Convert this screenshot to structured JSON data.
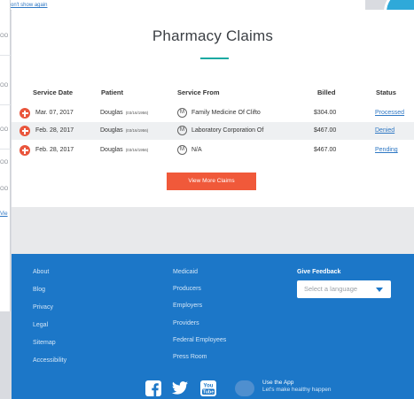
{
  "background": {
    "top_link_fragment": "on't show again",
    "side_fragments": [
      "OO",
      "OO",
      "OO",
      "OO",
      "OO"
    ],
    "side_link_fragment": "Vie"
  },
  "modal": {
    "title": "Pharmacy Claims",
    "columns": {
      "service_date": "Service Date",
      "patient": "Patient",
      "service_from": "Service From",
      "billed": "Billed",
      "status": "Status"
    },
    "rows": [
      {
        "service_date": "Mar. 07, 2017",
        "patient": "Douglas",
        "dob": "(03/16/1956)",
        "badge": "M",
        "service_from": "Family Medicine Of Clifto",
        "billed": "$304.00",
        "status": "Processed"
      },
      {
        "service_date": "Feb. 28, 2017",
        "patient": "Douglas",
        "dob": "(03/16/1956)",
        "badge": "M",
        "service_from": "Laboratory Corporation Of",
        "billed": "$467.00",
        "status": "Denied"
      },
      {
        "service_date": "Feb. 28, 2017",
        "patient": "Douglas",
        "dob": "(03/16/1956)",
        "badge": "M",
        "service_from": "N/A",
        "billed": "$467.00",
        "status": "Pending"
      }
    ],
    "view_more_label": "View More Claims"
  },
  "footer": {
    "col1": [
      "About",
      "Blog",
      "Privacy",
      "Legal",
      "Sitemap",
      "Accessibility"
    ],
    "col2": [
      "Medicaid",
      "Producers",
      "Employers",
      "Providers",
      "Federal Employees",
      "Press Room"
    ],
    "feedback_heading": "Give Feedback",
    "language_placeholder": "Select a language",
    "app_line1": "Use the App",
    "app_line2": "Let's make healthy happen",
    "social_youtube_text_top": "You",
    "social_youtube_text_bottom": "Tube"
  },
  "colors": {
    "accent": "#1ba9a2",
    "button": "#f0593a",
    "footer": "#1c77c8",
    "link": "#2f78c4"
  }
}
